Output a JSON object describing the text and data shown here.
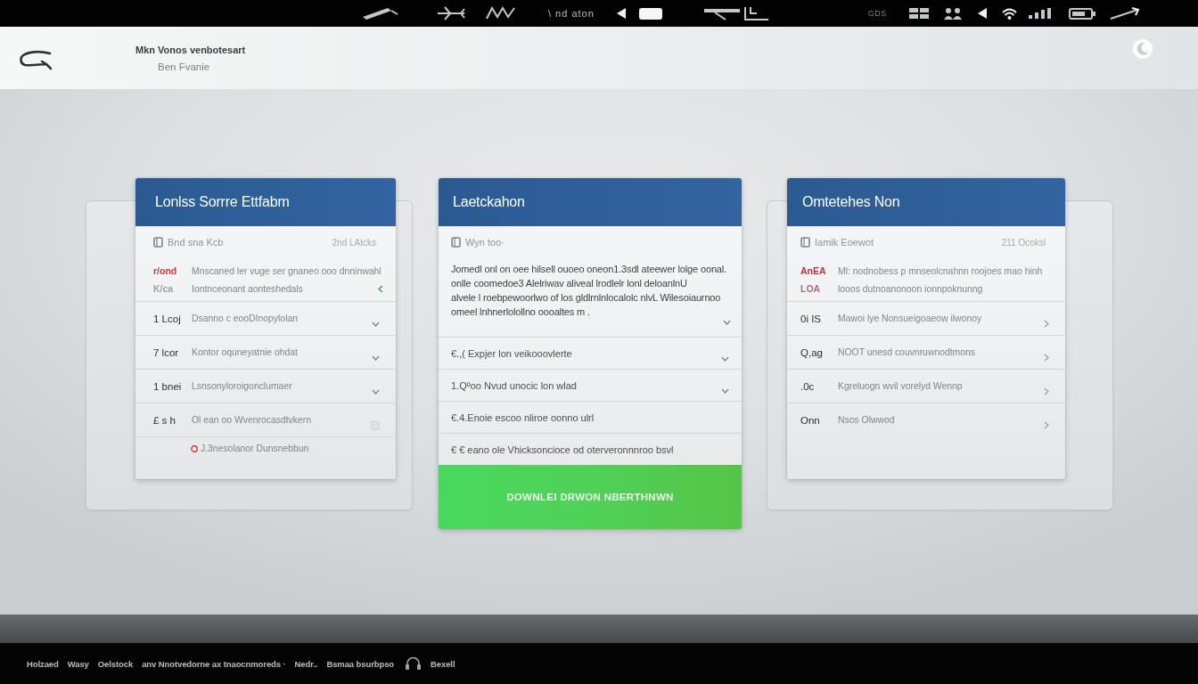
{
  "status_bar": {
    "center_text": "\\ nd aton",
    "right_text": "GDS"
  },
  "header": {
    "title": "Mkn Vonos venbotesart",
    "subtitle": "Ben Fvanie"
  },
  "cards": [
    {
      "title": "Lonlss Sorrre Ettfabm",
      "summary": {
        "label": "Bnd sna Kcb",
        "meta": "2nd LAtcks"
      },
      "rows": [
        {
          "kind": "marked",
          "codes": [
            {
              "text": "r/ond",
              "color": "#c43a3a"
            },
            {
              "text": "K/ca",
              "color": "#9aa0a6"
            }
          ],
          "lines": [
            "Mnscaned ler vuge ser gnaneo ooo dnninwahl",
            "Iontnceonant aonteshedals"
          ]
        },
        {
          "kind": "item",
          "code": "1 Lcoj",
          "text": "Dsanno c eooDInopylolan"
        },
        {
          "kind": "item",
          "code": "7 lcor",
          "text": "Kontor oquneyatnie ohdat"
        },
        {
          "kind": "item",
          "code": "1 bnei",
          "text": "Lsnsonyloroigonclumaer"
        },
        {
          "kind": "muted",
          "code": "£ s h",
          "text": "Ol ean oo Wvenrocasdtvkern"
        },
        {
          "kind": "note",
          "text": "J.3nesolanor Dunsnebbun"
        }
      ]
    },
    {
      "title": "Laetckahon",
      "summary": {
        "label": "Wyn too·"
      },
      "paragraph": {
        "lines": [
          "Jomedl onl on oee hilsell ouoeo oneon1.3sdl ateewer lolge oonal.",
          "onlle coomedoe3 Alelriwav aliveal lrodlelr lonl deloanlnU",
          "alvele l roebpewoorlwo of los gldlrnlnlocalolc nlvL Wilesoiaurnoo",
          "omeel lnhnerlolollno oooaltes m ."
        ]
      },
      "rows": [
        {
          "kind": "line",
          "text": "€.,( Expjer lon veikooovlerte"
        },
        {
          "kind": "line",
          "text": "1.Qºoo Nvud unocic lon wlad"
        },
        {
          "kind": "plain",
          "text": "€.4.Enoie escoo nliroe oonno ulrl"
        },
        {
          "kind": "plain",
          "text": "€ € eano ole Vhicksoncioce od oterveronnnroo bsvl"
        }
      ],
      "button": "DOWNLEI DRWON NBERTHNWN"
    },
    {
      "title": "Omtetehes Non",
      "summary": {
        "label": "Iamik Eoewot",
        "meta": "211 Ocoksl"
      },
      "rows": [
        {
          "kind": "detail",
          "codes": [
            {
              "text": "AnEA",
              "color": "#b8323f"
            },
            {
              "text": "LOA",
              "color": "#b06a7c"
            }
          ],
          "lines": [
            "Ml: nodnobess p mnseolcnahnn roojoes mao hinh",
            "looos dutnoanonoon ionnpoknunng"
          ]
        },
        {
          "kind": "item",
          "code": "0i IS",
          "text": "Mawoi lye Nonsueigoaeow ilwonoy"
        },
        {
          "kind": "item",
          "code": "Q,ag",
          "text": "NOOT unesd couvnruwnodtmons"
        },
        {
          "kind": "item",
          "code": ".0c",
          "text": "Kgreluogn wvil vorelyd Wennp"
        },
        {
          "kind": "item",
          "code": "Onn",
          "text": "Nsos Olwwod"
        }
      ]
    }
  ],
  "footer": {
    "links": [
      "Holzaed",
      "Wasy",
      "Oelstock",
      "anv Nnotvedorne ax tnaocnmoreds ·",
      "Nedr..",
      "Bsmaa bsurbpso"
    ],
    "label": "Bexell"
  }
}
